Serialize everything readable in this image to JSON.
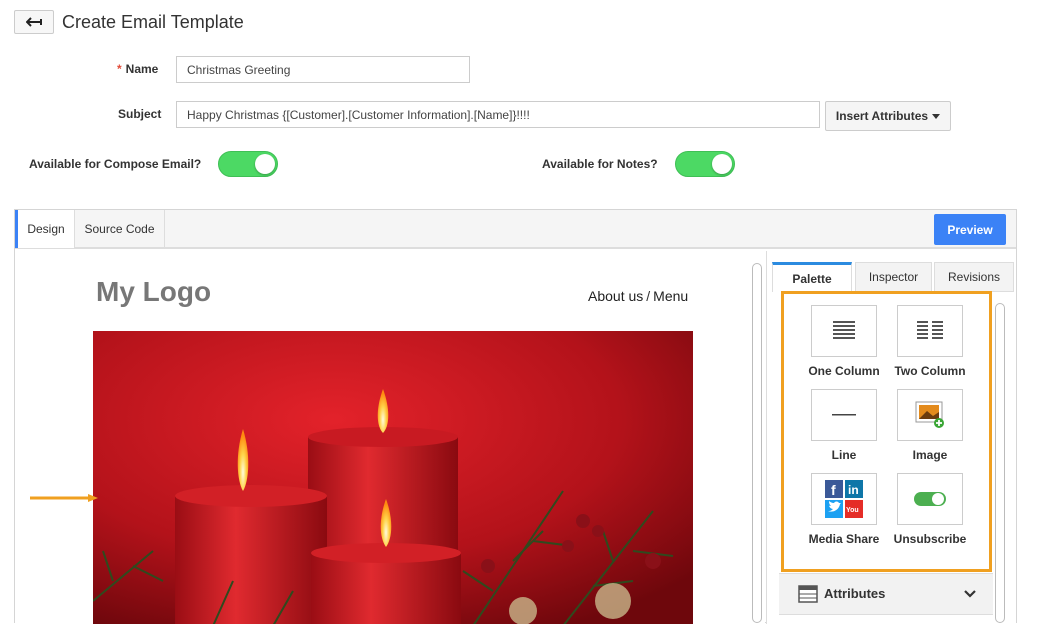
{
  "header": {
    "title": "Create Email Template"
  },
  "form": {
    "name_required_mark": "*",
    "name_label": "Name",
    "name_value": "Christmas Greeting",
    "subject_label": "Subject",
    "subject_value": "Happy Christmas {[Customer].[Customer Information].[Name]}!!!!",
    "insert_attributes_label": "Insert Attributes",
    "compose_label": "Available for Compose Email?",
    "compose_on": true,
    "notes_label": "Available for Notes?",
    "notes_on": true
  },
  "editor": {
    "tabs": [
      "Design",
      "Source Code"
    ],
    "active_tab": "Design",
    "preview_label": "Preview",
    "canvas": {
      "logo_text": "My Logo",
      "nav_about": "About us",
      "nav_sep": "/",
      "nav_menu": "Menu"
    }
  },
  "side_panel": {
    "tabs": [
      "Palette",
      "Inspector",
      "Revisions"
    ],
    "active_tab": "Palette",
    "items": [
      {
        "label": "One Column",
        "icon": "one-column-icon"
      },
      {
        "label": "Two Column",
        "icon": "two-column-icon"
      },
      {
        "label": "Line",
        "icon": "line-icon"
      },
      {
        "label": "Image",
        "icon": "image-icon"
      },
      {
        "label": "Media Share",
        "icon": "media-share-icon"
      },
      {
        "label": "Unsubscribe",
        "icon": "unsubscribe-toggle-icon"
      }
    ],
    "attributes_label": "Attributes"
  },
  "colors": {
    "accent": "#3b82f6",
    "toggle_on": "#4cd964",
    "highlight": "#f0a020"
  }
}
